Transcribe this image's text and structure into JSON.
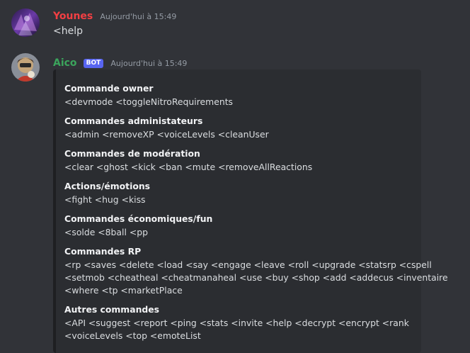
{
  "messages": [
    {
      "username": "Younes",
      "username_color": "#f23f43",
      "timestamp": "Aujourd'hui à 15:49",
      "content": "<help"
    },
    {
      "username": "Aico",
      "username_color": "#3ba55c",
      "bot_tag": "BOT",
      "timestamp": "Aujourd'hui à 15:49"
    }
  ],
  "embed": {
    "fields": [
      {
        "name": "Commande owner",
        "lines": [
          "<devmode <toggleNitroRequirements"
        ]
      },
      {
        "name": "Commandes administateurs",
        "lines": [
          "<admin <removeXP <voiceLevels <cleanUser"
        ]
      },
      {
        "name": "Commandes de modération",
        "lines": [
          "<clear <ghost <kick <ban <mute <removeAllReactions"
        ]
      },
      {
        "name": "Actions/émotions",
        "lines": [
          "<fight <hug <kiss"
        ]
      },
      {
        "name": "Commandes économiques/fun",
        "lines": [
          "<solde <8ball <pp"
        ]
      },
      {
        "name": "Commandes RP",
        "lines": [
          "<rp <saves <delete <load <say <engage <leave <roll <upgrade <statsrp <cspell",
          "<setmob <cheatheal <cheatmanaheal <use <buy <shop <add <addecus <inventaire",
          "<where <tp <marketPlace"
        ]
      },
      {
        "name": "Autres commandes",
        "lines": [
          "<API <suggest <report <ping <stats <invite <help <decrypt <encrypt <rank",
          "<voiceLevels <top <emoteList"
        ]
      }
    ]
  }
}
